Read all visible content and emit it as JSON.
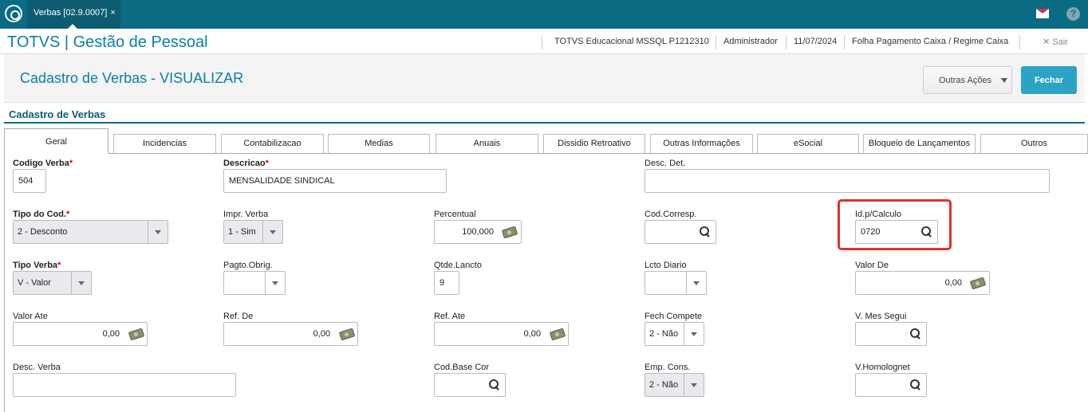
{
  "topbar": {
    "tab_label": "Verbas [02.9.0007]",
    "tab_close": "×"
  },
  "header": {
    "app_title": "TOTVS | Gestão de Pessoal",
    "environment": "TOTVS Educacional MSSQL P1212310",
    "user": "Administrador",
    "date": "11/07/2024",
    "payroll": "Folha Pagamento Caixa / Regime Caixa",
    "logout": "Sair",
    "logout_icon": "✕"
  },
  "page": {
    "title": "Cadastro de Verbas - VISUALIZAR",
    "outras_acoes": "Outras Ações",
    "fechar": "Fechar"
  },
  "section": {
    "title": "Cadastro de Verbas"
  },
  "tabs": [
    "Geral",
    "Incidencias",
    "Contabilizacao",
    "Medias",
    "Anuais",
    "Dissidio Retroativo",
    "Outras Informações",
    "eSocial",
    "Bloqueio de Lançamentos",
    "Outros"
  ],
  "fields": {
    "codigo_verba": {
      "label": "Codigo Verba",
      "value": "504"
    },
    "descricao": {
      "label": "Descricao",
      "value": "MENSALIDADE SINDICAL"
    },
    "desc_det": {
      "label": "Desc. Det.",
      "value": ""
    },
    "tipo_cod": {
      "label": "Tipo do Cod.",
      "value": "2 - Desconto"
    },
    "impr_verba": {
      "label": "Impr. Verba",
      "value": "1 - Sim"
    },
    "percentual": {
      "label": "Percentual",
      "value": "100,000"
    },
    "cod_corresp": {
      "label": "Cod.Corresp.",
      "value": ""
    },
    "id_calculo": {
      "label": "Id.p/Calculo",
      "value": "0720"
    },
    "tipo_verba": {
      "label": "Tipo Verba",
      "value": "V - Valor"
    },
    "pagto_obrig": {
      "label": "Pagto.Obrig.",
      "value": ""
    },
    "qtde_lancto": {
      "label": "Qtde.Lancto",
      "value": "9"
    },
    "lcto_diario": {
      "label": "Lcto Diario",
      "value": ""
    },
    "valor_de": {
      "label": "Valor De",
      "value": "0,00"
    },
    "valor_ate": {
      "label": "Valor Ate",
      "value": "0,00"
    },
    "ref_de": {
      "label": "Ref. De",
      "value": "0,00"
    },
    "ref_ate": {
      "label": "Ref. Ate",
      "value": "0,00"
    },
    "fech_compete": {
      "label": "Fech Compete",
      "value": "2 - Não"
    },
    "v_mes_segui": {
      "label": "V. Mes Segui",
      "value": ""
    },
    "desc_verba": {
      "label": "Desc. Verba",
      "value": ""
    },
    "cod_base_cor": {
      "label": "Cod.Base Cor",
      "value": ""
    },
    "emp_cons": {
      "label": "Emp. Cons.",
      "value": "2 - Não"
    },
    "v_homolognet": {
      "label": "V.Homolognet",
      "value": ""
    }
  },
  "required_mark": "*",
  "icons": {
    "help": "?",
    "highlight_color": "#e03030",
    "accent": "#0a6b83"
  }
}
